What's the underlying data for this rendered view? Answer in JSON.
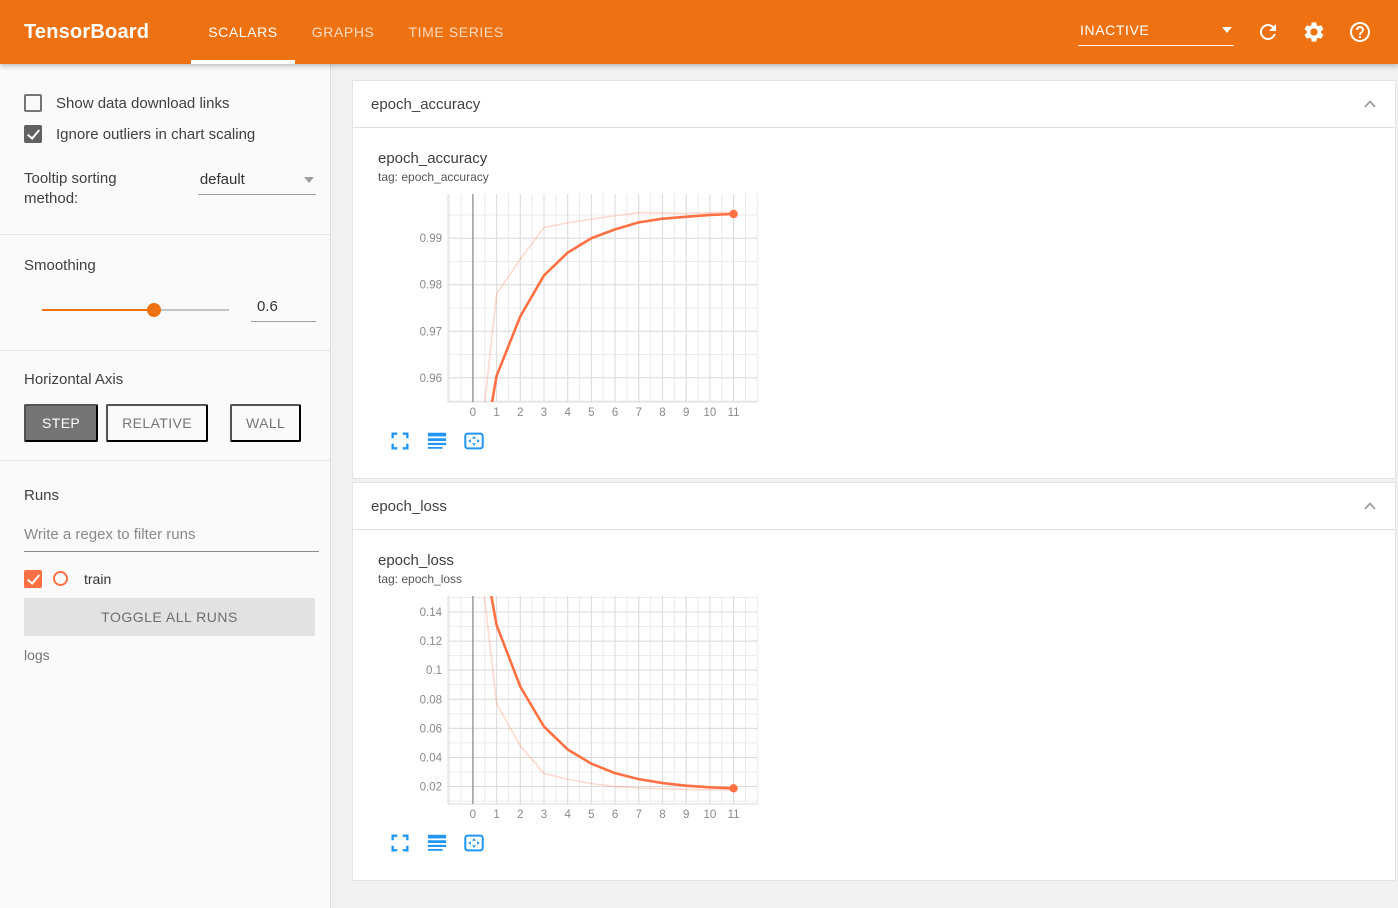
{
  "colors": {
    "header_bg": "#ee7211",
    "run_color": "#ff7043",
    "icon_blue": "#2196f3",
    "grid_minor": "#ececec",
    "grid_major": "#dcdcdc",
    "zero_line": "#9c9c9c"
  },
  "header": {
    "logo": "TensorBoard",
    "tabs": [
      {
        "label": "SCALARS",
        "active": true
      },
      {
        "label": "GRAPHS",
        "active": false
      },
      {
        "label": "TIME SERIES",
        "active": false
      }
    ],
    "status_dropdown": {
      "value": "INACTIVE"
    }
  },
  "sidebar": {
    "show_download": {
      "label": "Show data download links",
      "checked": false
    },
    "ignore_outliers": {
      "label": "Ignore outliers in chart scaling",
      "checked": true
    },
    "tooltip_sorting": {
      "label": "Tooltip sorting method:",
      "value": "default"
    },
    "smoothing": {
      "label": "Smoothing",
      "value": "0.6"
    },
    "horizontal_axis": {
      "label": "Horizontal Axis",
      "options": [
        "STEP",
        "RELATIVE",
        "WALL"
      ],
      "selected": "STEP"
    },
    "runs": {
      "label": "Runs",
      "filter_placeholder": "Write a regex to filter runs",
      "items": [
        {
          "name": "train",
          "checked": true
        }
      ],
      "toggle_all_label": "TOGGLE ALL RUNS",
      "footer": "logs"
    }
  },
  "cards": [
    {
      "header": "epoch_accuracy",
      "title": "epoch_accuracy",
      "tag": "tag: epoch_accuracy"
    },
    {
      "header": "epoch_loss",
      "title": "epoch_loss",
      "tag": "tag: epoch_loss"
    }
  ],
  "chart_data": [
    {
      "type": "line",
      "title": "epoch_accuracy",
      "tag": "epoch_accuracy",
      "run": "train",
      "smoothing": 0.6,
      "x": [
        0,
        1,
        2,
        3,
        4,
        5,
        6,
        7,
        8,
        9,
        10,
        11
      ],
      "series": [
        {
          "name": "train (raw)",
          "style": "faint",
          "values": [
            0.931,
            0.978,
            0.9855,
            0.9923,
            0.9933,
            0.9941,
            0.9948,
            0.9955,
            0.9954,
            0.9953,
            0.9955,
            0.9956
          ]
        },
        {
          "name": "train (smoothed 0.6)",
          "style": "bold",
          "end_dot": true,
          "values": [
            0.931,
            0.9604,
            0.9732,
            0.982,
            0.9869,
            0.99,
            0.9919,
            0.9934,
            0.9942,
            0.9946,
            0.995,
            0.9952
          ]
        }
      ],
      "xlim": [
        -1.05,
        12.03
      ],
      "ylim": [
        0.9548,
        0.9995
      ],
      "x_ticks": [
        0,
        1,
        2,
        3,
        4,
        5,
        6,
        7,
        8,
        9,
        10,
        11
      ],
      "x_tick_labels": [
        "0",
        "1",
        "2",
        "3",
        "4",
        "5",
        "6",
        "7",
        "8",
        "9",
        "10",
        "11"
      ],
      "x_minor_step": 0.5,
      "y_ticks": [
        0.96,
        0.97,
        0.98,
        0.99
      ],
      "y_tick_labels": [
        "0.96",
        "0.97",
        "0.98",
        "0.99"
      ],
      "y_minor_step": 0.005,
      "zero_line_x": 0,
      "grid": true,
      "legend": "none"
    },
    {
      "type": "line",
      "title": "epoch_loss",
      "tag": "epoch_loss",
      "run": "train",
      "smoothing": 0.6,
      "x": [
        0,
        1,
        2,
        3,
        4,
        5,
        6,
        7,
        8,
        9,
        10,
        11
      ],
      "series": [
        {
          "name": "train (raw)",
          "style": "faint",
          "values": [
            0.221,
            0.077,
            0.048,
            0.029,
            0.025,
            0.022,
            0.02,
            0.019,
            0.0185,
            0.018,
            0.0178,
            0.0177
          ]
        },
        {
          "name": "train (smoothed 0.6)",
          "style": "bold",
          "end_dot": true,
          "values": [
            0.221,
            0.131,
            0.0887,
            0.0612,
            0.0455,
            0.0357,
            0.0292,
            0.0251,
            0.0224,
            0.0206,
            0.0195,
            0.0188
          ]
        }
      ],
      "xlim": [
        -1.05,
        12.03
      ],
      "ylim": [
        0.008,
        0.151
      ],
      "x_ticks": [
        0,
        1,
        2,
        3,
        4,
        5,
        6,
        7,
        8,
        9,
        10,
        11
      ],
      "x_tick_labels": [
        "0",
        "1",
        "2",
        "3",
        "4",
        "5",
        "6",
        "7",
        "8",
        "9",
        "10",
        "11"
      ],
      "x_minor_step": 0.5,
      "y_ticks": [
        0.02,
        0.04,
        0.06,
        0.08,
        0.1,
        0.12,
        0.14
      ],
      "y_tick_labels": [
        "0.02",
        "0.04",
        "0.06",
        "0.08",
        "0.1",
        "0.12",
        "0.14"
      ],
      "y_minor_step": 0.01,
      "zero_line_x": 0,
      "grid": true,
      "legend": "none"
    }
  ]
}
